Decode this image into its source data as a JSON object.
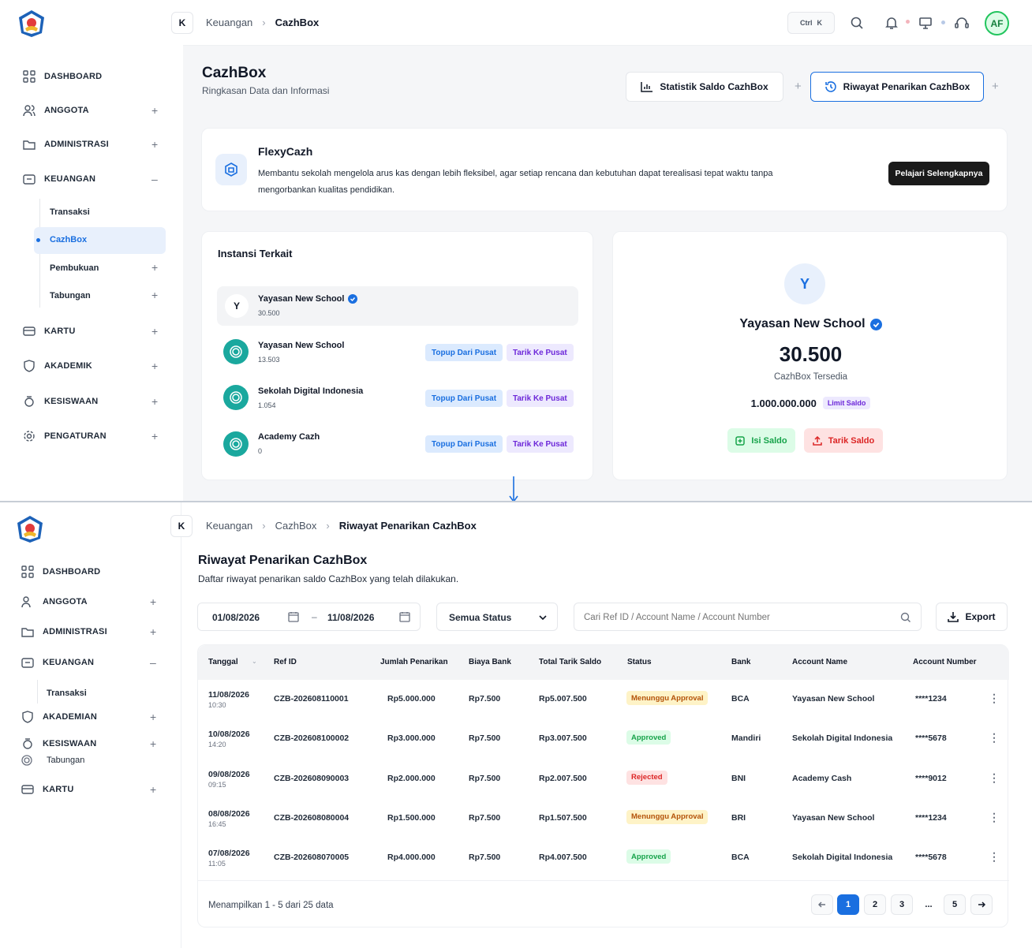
{
  "top": {
    "breadcrumb": {
      "k": "K",
      "parent": "Keuangan",
      "current": "CazhBox"
    },
    "topbar": {
      "ctrl": "Ctrl",
      "k": "K",
      "avatar": "AF"
    },
    "sidebar": {
      "items": [
        {
          "label": "DASHBOARD",
          "icon": "grid-icon"
        },
        {
          "label": "ANGGOTA",
          "icon": "users-icon"
        },
        {
          "label": "ADMINISTRASI",
          "icon": "folder-icon"
        },
        {
          "label": "KEUANGAN",
          "icon": "wallet-icon"
        },
        {
          "label": "KARTU",
          "icon": "card-icon"
        },
        {
          "label": "AKADEMIK",
          "icon": "shield-icon"
        },
        {
          "label": "KESISWAAN",
          "icon": "student-icon"
        },
        {
          "label": "PENGATURAN",
          "icon": "gear-icon"
        }
      ],
      "sub": {
        "transaksi": "Transaksi",
        "cazhbox": "CazhBox",
        "pembukuan": "Pembukuan",
        "tabungan": "Tabungan"
      }
    },
    "page": {
      "title": "CazhBox",
      "subtitle": "Ringkasan Data dan Informasi"
    },
    "actions": {
      "stat": "Statistik Saldo CazhBox",
      "riwayat": "Riwayat Penarikan CazhBox"
    },
    "flexy": {
      "title": "FlexyCazh",
      "desc1": "Membantu sekolah mengelola arus kas dengan lebih fleksibel, agar setiap rencana dan kebutuhan dapat terealisasi tepat waktu tanpa",
      "desc2": "mengorbankan kualitas pendidikan.",
      "button": "Pelajari Selengkapnya"
    },
    "instansi": {
      "title": "Instansi Terkait",
      "main": {
        "initial": "Y",
        "name": "Yayasan New School",
        "amount": "30.500"
      },
      "items": [
        {
          "name": "Yayasan New School",
          "amount": "13.503"
        },
        {
          "name": "Sekolah Digital Indonesia",
          "amount": "1.054"
        },
        {
          "name": "Academy Cazh",
          "amount": "0"
        }
      ],
      "topup": "Topup Dari Pusat",
      "tarik": "Tarik Ke Pusat"
    },
    "balance": {
      "initial": "Y",
      "name": "Yayasan New School",
      "amount": "30.500",
      "caption": "CazhBox Tersedia",
      "limit": "1.000.000.000",
      "limit_badge": "Limit Saldo",
      "isi": "Isi Saldo",
      "tarik": "Tarik Saldo"
    }
  },
  "bottom": {
    "breadcrumb": {
      "k": "K",
      "p1": "Keuangan",
      "p2": "CazhBox",
      "current": "Riwayat Penarikan CazhBox"
    },
    "sidebar": {
      "items": [
        "DASHBOARD",
        "ANGGOTA",
        "ADMINISTRASI",
        "KEUANGAN",
        "AKADEMIAN",
        "KESISWAAN",
        "KARTU"
      ],
      "sub_transaksi": "Transaksi",
      "sub_tabungan": "Tabungan"
    },
    "page": {
      "title": "Riwayat Penarikan CazhBox",
      "subtitle": "Daftar riwayat penarikan saldo CazhBox yang telah dilakukan."
    },
    "filters": {
      "date_from": "01/08/2026",
      "date_sep": "–",
      "date_to": "11/08/2026",
      "status": "Semua Status",
      "search_placeholder": "Cari Ref ID / Account Name / Account Number",
      "export": "Export"
    },
    "table": {
      "headers": [
        "Tanggal",
        "Ref ID",
        "Jumlah Penarikan",
        "Biaya Bank",
        "Total Tarik Saldo",
        "Status",
        "Bank",
        "Account Name",
        "Account Number"
      ],
      "rows": [
        {
          "date": "11/08/2026",
          "time": "10:30",
          "ref": "CZB-202608110001",
          "jumlah": "Rp5.000.000",
          "biaya": "Rp7.500",
          "total": "Rp5.007.500",
          "status": "Menunggu Approval",
          "bank": "BCA",
          "name": "Yayasan New School",
          "acct": "****1234"
        },
        {
          "date": "10/08/2026",
          "time": "14:20",
          "ref": "CZB-202608100002",
          "jumlah": "Rp3.000.000",
          "biaya": "Rp7.500",
          "total": "Rp3.007.500",
          "status": "Approved",
          "bank": "Mandiri",
          "name": "Sekolah Digital Indonesia",
          "acct": "****5678"
        },
        {
          "date": "09/08/2026",
          "time": "09:15",
          "ref": "CZB-202608090003",
          "jumlah": "Rp2.000.000",
          "biaya": "Rp7.500",
          "total": "Rp2.007.500",
          "status": "Rejected",
          "bank": "BNI",
          "name": "Academy Cash",
          "acct": "****9012"
        },
        {
          "date": "08/08/2026",
          "time": "16:45",
          "ref": "CZB-202608080004",
          "jumlah": "Rp1.500.000",
          "biaya": "Rp7.500",
          "total": "Rp1.507.500",
          "status": "Menunggu Approval",
          "bank": "BRI",
          "name": "Yayasan New School",
          "acct": "****1234"
        },
        {
          "date": "07/08/2026",
          "time": "11:05",
          "ref": "CZB-202608070005",
          "jumlah": "Rp4.000.000",
          "biaya": "Rp7.500",
          "total": "Rp4.007.500",
          "status": "Approved",
          "bank": "BCA",
          "name": "Sekolah Digital Indonesia",
          "acct": "****5678"
        }
      ]
    },
    "pagination": {
      "summary": "Menampilkan 1 - 5 dari 25 data",
      "pages": [
        "1",
        "2",
        "3",
        "...",
        "5"
      ]
    }
  },
  "colors": {
    "accent": "#1a6fe0",
    "approved_bg": "#dcfce7",
    "approved_fg": "#16a34a",
    "pending_bg": "#fef3c7",
    "pending_fg": "#b45309",
    "rejected_bg": "#fee2e2",
    "rejected_fg": "#dc2626"
  }
}
